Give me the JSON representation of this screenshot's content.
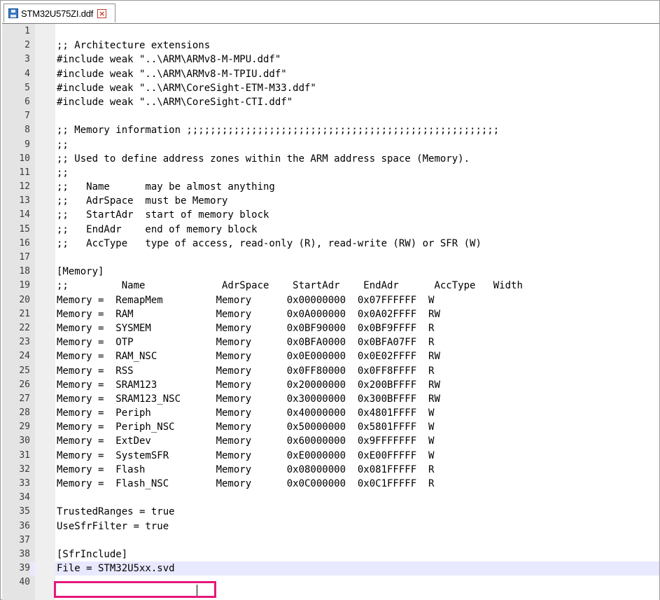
{
  "tab": {
    "filename": "STM32U575ZI.ddf",
    "save_icon": "save-disk-icon",
    "close_icon": "close-x-icon"
  },
  "editor": {
    "lines": [
      {
        "n": "1",
        "text": ""
      },
      {
        "n": "2",
        "text": ";; Architecture extensions"
      },
      {
        "n": "3",
        "text": "#include weak \"..\\ARM\\ARMv8-M-MPU.ddf\""
      },
      {
        "n": "4",
        "text": "#include weak \"..\\ARM\\ARMv8-M-TPIU.ddf\""
      },
      {
        "n": "5",
        "text": "#include weak \"..\\ARM\\CoreSight-ETM-M33.ddf\""
      },
      {
        "n": "6",
        "text": "#include weak \"..\\ARM\\CoreSight-CTI.ddf\""
      },
      {
        "n": "7",
        "text": ""
      },
      {
        "n": "8",
        "text": ";; Memory information ;;;;;;;;;;;;;;;;;;;;;;;;;;;;;;;;;;;;;;;;;;;;;;;;;;;;;"
      },
      {
        "n": "9",
        "text": ";;"
      },
      {
        "n": "10",
        "text": ";; Used to define address zones within the ARM address space (Memory)."
      },
      {
        "n": "11",
        "text": ";;"
      },
      {
        "n": "12",
        "text": ";;   Name      may be almost anything"
      },
      {
        "n": "13",
        "text": ";;   AdrSpace  must be Memory"
      },
      {
        "n": "14",
        "text": ";;   StartAdr  start of memory block"
      },
      {
        "n": "15",
        "text": ";;   EndAdr    end of memory block"
      },
      {
        "n": "16",
        "text": ";;   AccType   type of access, read-only (R), read-write (RW) or SFR (W)"
      },
      {
        "n": "17",
        "text": ""
      },
      {
        "n": "18",
        "text": "[Memory]"
      },
      {
        "n": "19",
        "text": ";;         Name             AdrSpace    StartAdr    EndAdr      AccType   Width"
      },
      {
        "n": "20",
        "text": "Memory =  RemapMem         Memory      0x00000000  0x07FFFFFF  W"
      },
      {
        "n": "21",
        "text": "Memory =  RAM              Memory      0x0A000000  0x0A02FFFF  RW"
      },
      {
        "n": "22",
        "text": "Memory =  SYSMEM           Memory      0x0BF90000  0x0BF9FFFF  R"
      },
      {
        "n": "23",
        "text": "Memory =  OTP              Memory      0x0BFA0000  0x0BFA07FF  R"
      },
      {
        "n": "24",
        "text": "Memory =  RAM_NSC          Memory      0x0E000000  0x0E02FFFF  RW"
      },
      {
        "n": "25",
        "text": "Memory =  RSS              Memory      0x0FF80000  0x0FF8FFFF  R"
      },
      {
        "n": "26",
        "text": "Memory =  SRAM123          Memory      0x20000000  0x200BFFFF  RW"
      },
      {
        "n": "27",
        "text": "Memory =  SRAM123_NSC      Memory      0x30000000  0x300BFFFF  RW"
      },
      {
        "n": "28",
        "text": "Memory =  Periph           Memory      0x40000000  0x4801FFFF  W"
      },
      {
        "n": "29",
        "text": "Memory =  Periph_NSC       Memory      0x50000000  0x5801FFFF  W"
      },
      {
        "n": "30",
        "text": "Memory =  ExtDev           Memory      0x60000000  0x9FFFFFFF  W"
      },
      {
        "n": "31",
        "text": "Memory =  SystemSFR        Memory      0xE0000000  0xE00FFFFF  W"
      },
      {
        "n": "32",
        "text": "Memory =  Flash            Memory      0x08000000  0x081FFFFF  R"
      },
      {
        "n": "33",
        "text": "Memory =  Flash_NSC        Memory      0x0C000000  0x0C1FFFFF  R"
      },
      {
        "n": "34",
        "text": ""
      },
      {
        "n": "35",
        "text": "TrustedRanges = true"
      },
      {
        "n": "36",
        "text": "UseSfrFilter = true"
      },
      {
        "n": "37",
        "text": ""
      },
      {
        "n": "38",
        "text": "[SfrInclude]"
      },
      {
        "n": "39",
        "text": "File = STM32U5xx.svd"
      },
      {
        "n": "40",
        "text": ""
      }
    ],
    "current_line": "39",
    "highlight_color": "#e6177a"
  }
}
